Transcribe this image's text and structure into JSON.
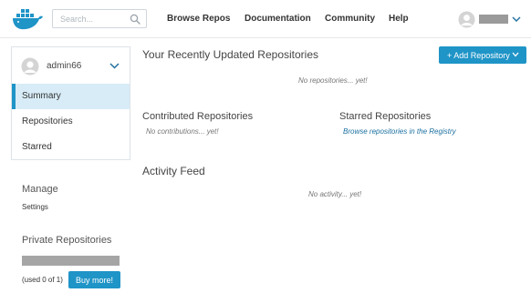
{
  "nav": {
    "search_placeholder": "Search...",
    "links": [
      "Browse Repos",
      "Documentation",
      "Community",
      "Help"
    ]
  },
  "sidebar": {
    "username": "admin66",
    "items": [
      {
        "label": "Summary",
        "active": true
      },
      {
        "label": "Repositories",
        "active": false
      },
      {
        "label": "Starred",
        "active": false
      }
    ],
    "manage_title": "Manage",
    "settings_label": "Settings",
    "private_title": "Private Repositories",
    "used_text": "(used 0 of 1)",
    "buy_label": "Buy more!"
  },
  "main": {
    "recent_title": "Your Recently Updated Repositories",
    "add_button_label": "+ Add Repository",
    "no_repos_text": "No repositories... yet!",
    "contributed_title": "Contributed Repositories",
    "no_contrib_text": "No contributions... yet!",
    "starred_title": "Starred Repositories",
    "browse_link": "Browse repositories in the Registry",
    "activity_title": "Activity Feed",
    "no_activity_text": "No activity... yet!"
  },
  "icons": {
    "logo": "docker-whale-icon",
    "search": "search-icon",
    "avatar": "user-avatar-icon",
    "chevron": "chevron-down-icon"
  },
  "colors": {
    "accent": "#1f94c7",
    "active_bg": "#d7ecf7",
    "link": "#1a6fa0"
  }
}
